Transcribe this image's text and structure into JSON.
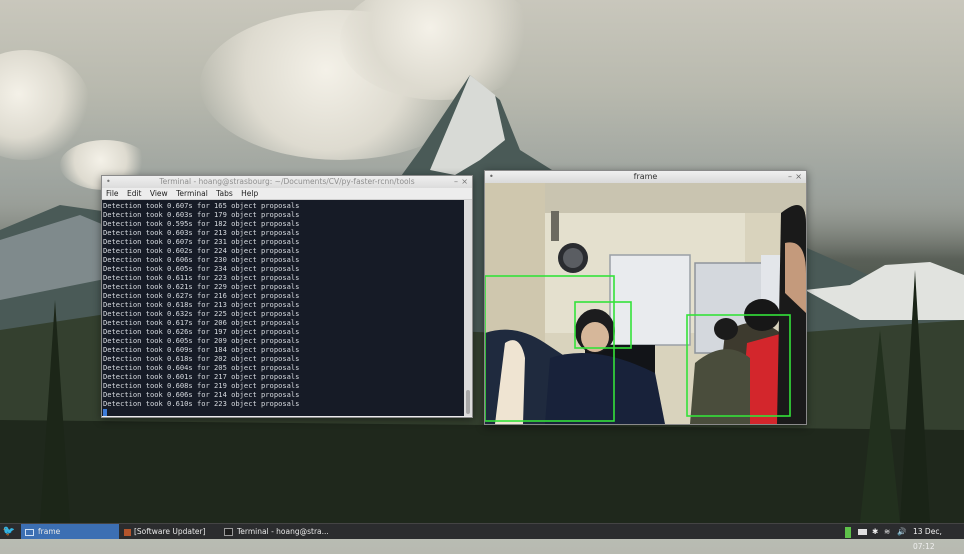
{
  "terminal": {
    "title": "Terminal - hoang@strasbourg: ~/Documents/CV/py-faster-rcnn/tools",
    "menu": [
      "File",
      "Edit",
      "View",
      "Terminal",
      "Tabs",
      "Help"
    ],
    "lines": [
      "Detection took 0.607s for 165 object proposals",
      "Detection took 0.603s for 179 object proposals",
      "Detection took 0.595s for 182 object proposals",
      "Detection took 0.603s for 213 object proposals",
      "Detection took 0.607s for 231 object proposals",
      "Detection took 0.602s for 224 object proposals",
      "Detection took 0.606s for 230 object proposals",
      "Detection took 0.605s for 234 object proposals",
      "Detection took 0.611s for 223 object proposals",
      "Detection took 0.621s for 229 object proposals",
      "Detection took 0.627s for 216 object proposals",
      "Detection took 0.618s for 213 object proposals",
      "Detection took 0.632s for 225 object proposals",
      "Detection took 0.617s for 206 object proposals",
      "Detection took 0.626s for 197 object proposals",
      "Detection took 0.605s for 209 object proposals",
      "Detection took 0.609s for 184 object proposals",
      "Detection took 0.618s for 202 object proposals",
      "Detection took 0.604s for 205 object proposals",
      "Detection took 0.601s for 217 object proposals",
      "Detection took 0.608s for 219 object proposals",
      "Detection took 0.606s for 214 object proposals",
      "Detection took 0.610s for 223 object proposals"
    ]
  },
  "frame": {
    "title": "frame",
    "box_color": "#34e23a"
  },
  "taskbar": {
    "start_icon": "bird-logo-icon",
    "items": [
      {
        "label": "frame",
        "active": true
      },
      {
        "label": "[Software Updater]",
        "active": false
      },
      {
        "label": "Terminal - hoang@stra...",
        "active": false
      }
    ],
    "clock": "13 Dec, 07:12"
  },
  "colors": {
    "terminal_bg": "#161b26",
    "taskbar_bg": "#2b2c2e",
    "active_task": "#3c6fb3"
  }
}
